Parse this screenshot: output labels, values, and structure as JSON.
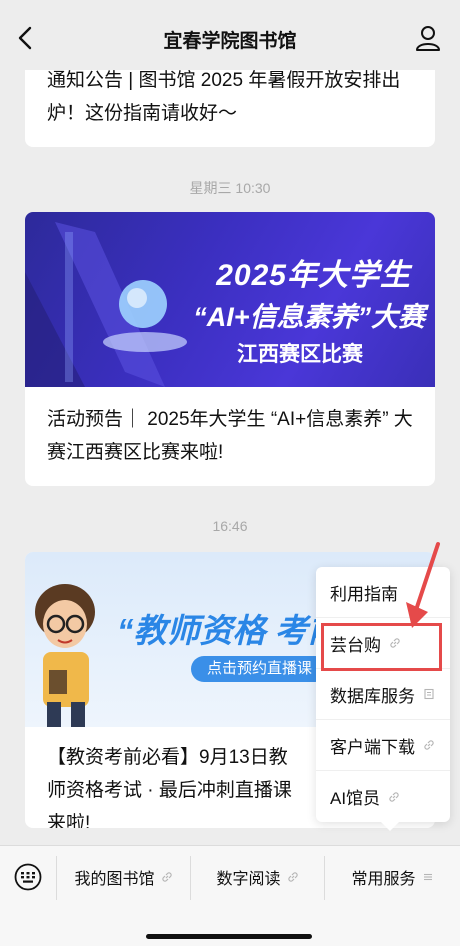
{
  "header": {
    "title": "宜春学院图书馆"
  },
  "feed": {
    "card1_text": "通知公告 | 图书馆 2025 年暑假开放安排出炉！这份指南请收好～",
    "time1": "星期三 10:30",
    "card2": {
      "banner_line1": "2025年大学生",
      "banner_line2": "“AI+信息素养”大赛",
      "banner_line3": "江西赛区比赛",
      "text": "活动预告｜ 2025年大学生 “AI+信息素养” 大赛江西赛区比赛来啦!"
    },
    "time2": "16:46",
    "card3": {
      "banner_line1": "“教师资格 考前",
      "banner_pill": "点击预约直播课",
      "text": "【教资考前必看】9月13日教师资格考试 · 最后冲刺直播课来啦!"
    }
  },
  "menu": {
    "items": [
      {
        "label": "利用指南",
        "icon": ""
      },
      {
        "label": "芸台购",
        "icon": "link-icon"
      },
      {
        "label": "数据库服务",
        "icon": "doc-icon"
      },
      {
        "label": "客户端下载",
        "icon": "link-icon"
      },
      {
        "label": "AI馆员",
        "icon": "link-icon"
      }
    ]
  },
  "bottom": {
    "tab1": "我的图书馆",
    "tab2": "数字阅读",
    "tab3": "常用服务"
  },
  "colors": {
    "highlight": "#e54a4a",
    "accent": "#3a8fe8"
  }
}
